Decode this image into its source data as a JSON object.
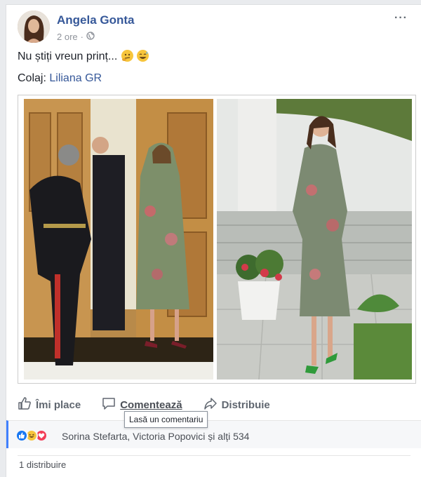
{
  "post": {
    "author": "Angela Gonta",
    "time": "2 ore",
    "separator": "·",
    "more_icon": "···",
    "text_line": "Nu știți vreun prinț...",
    "collage_label": "Colaj:",
    "collage_author": "Liliana GR"
  },
  "actions": {
    "like": "Îmi place",
    "comment": "Comentează",
    "share": "Distribuie"
  },
  "tooltip": "Lasă un comentariu",
  "reactions": {
    "names": "Sorina Stefarta, Victoria Popovici și alți 534",
    "icons": [
      "like-icon",
      "haha-icon",
      "love-icon"
    ],
    "colors": {
      "like": "#1877f2",
      "haha": "#f7c53c",
      "love": "#f33e58"
    }
  },
  "shares": "1 distribuire"
}
